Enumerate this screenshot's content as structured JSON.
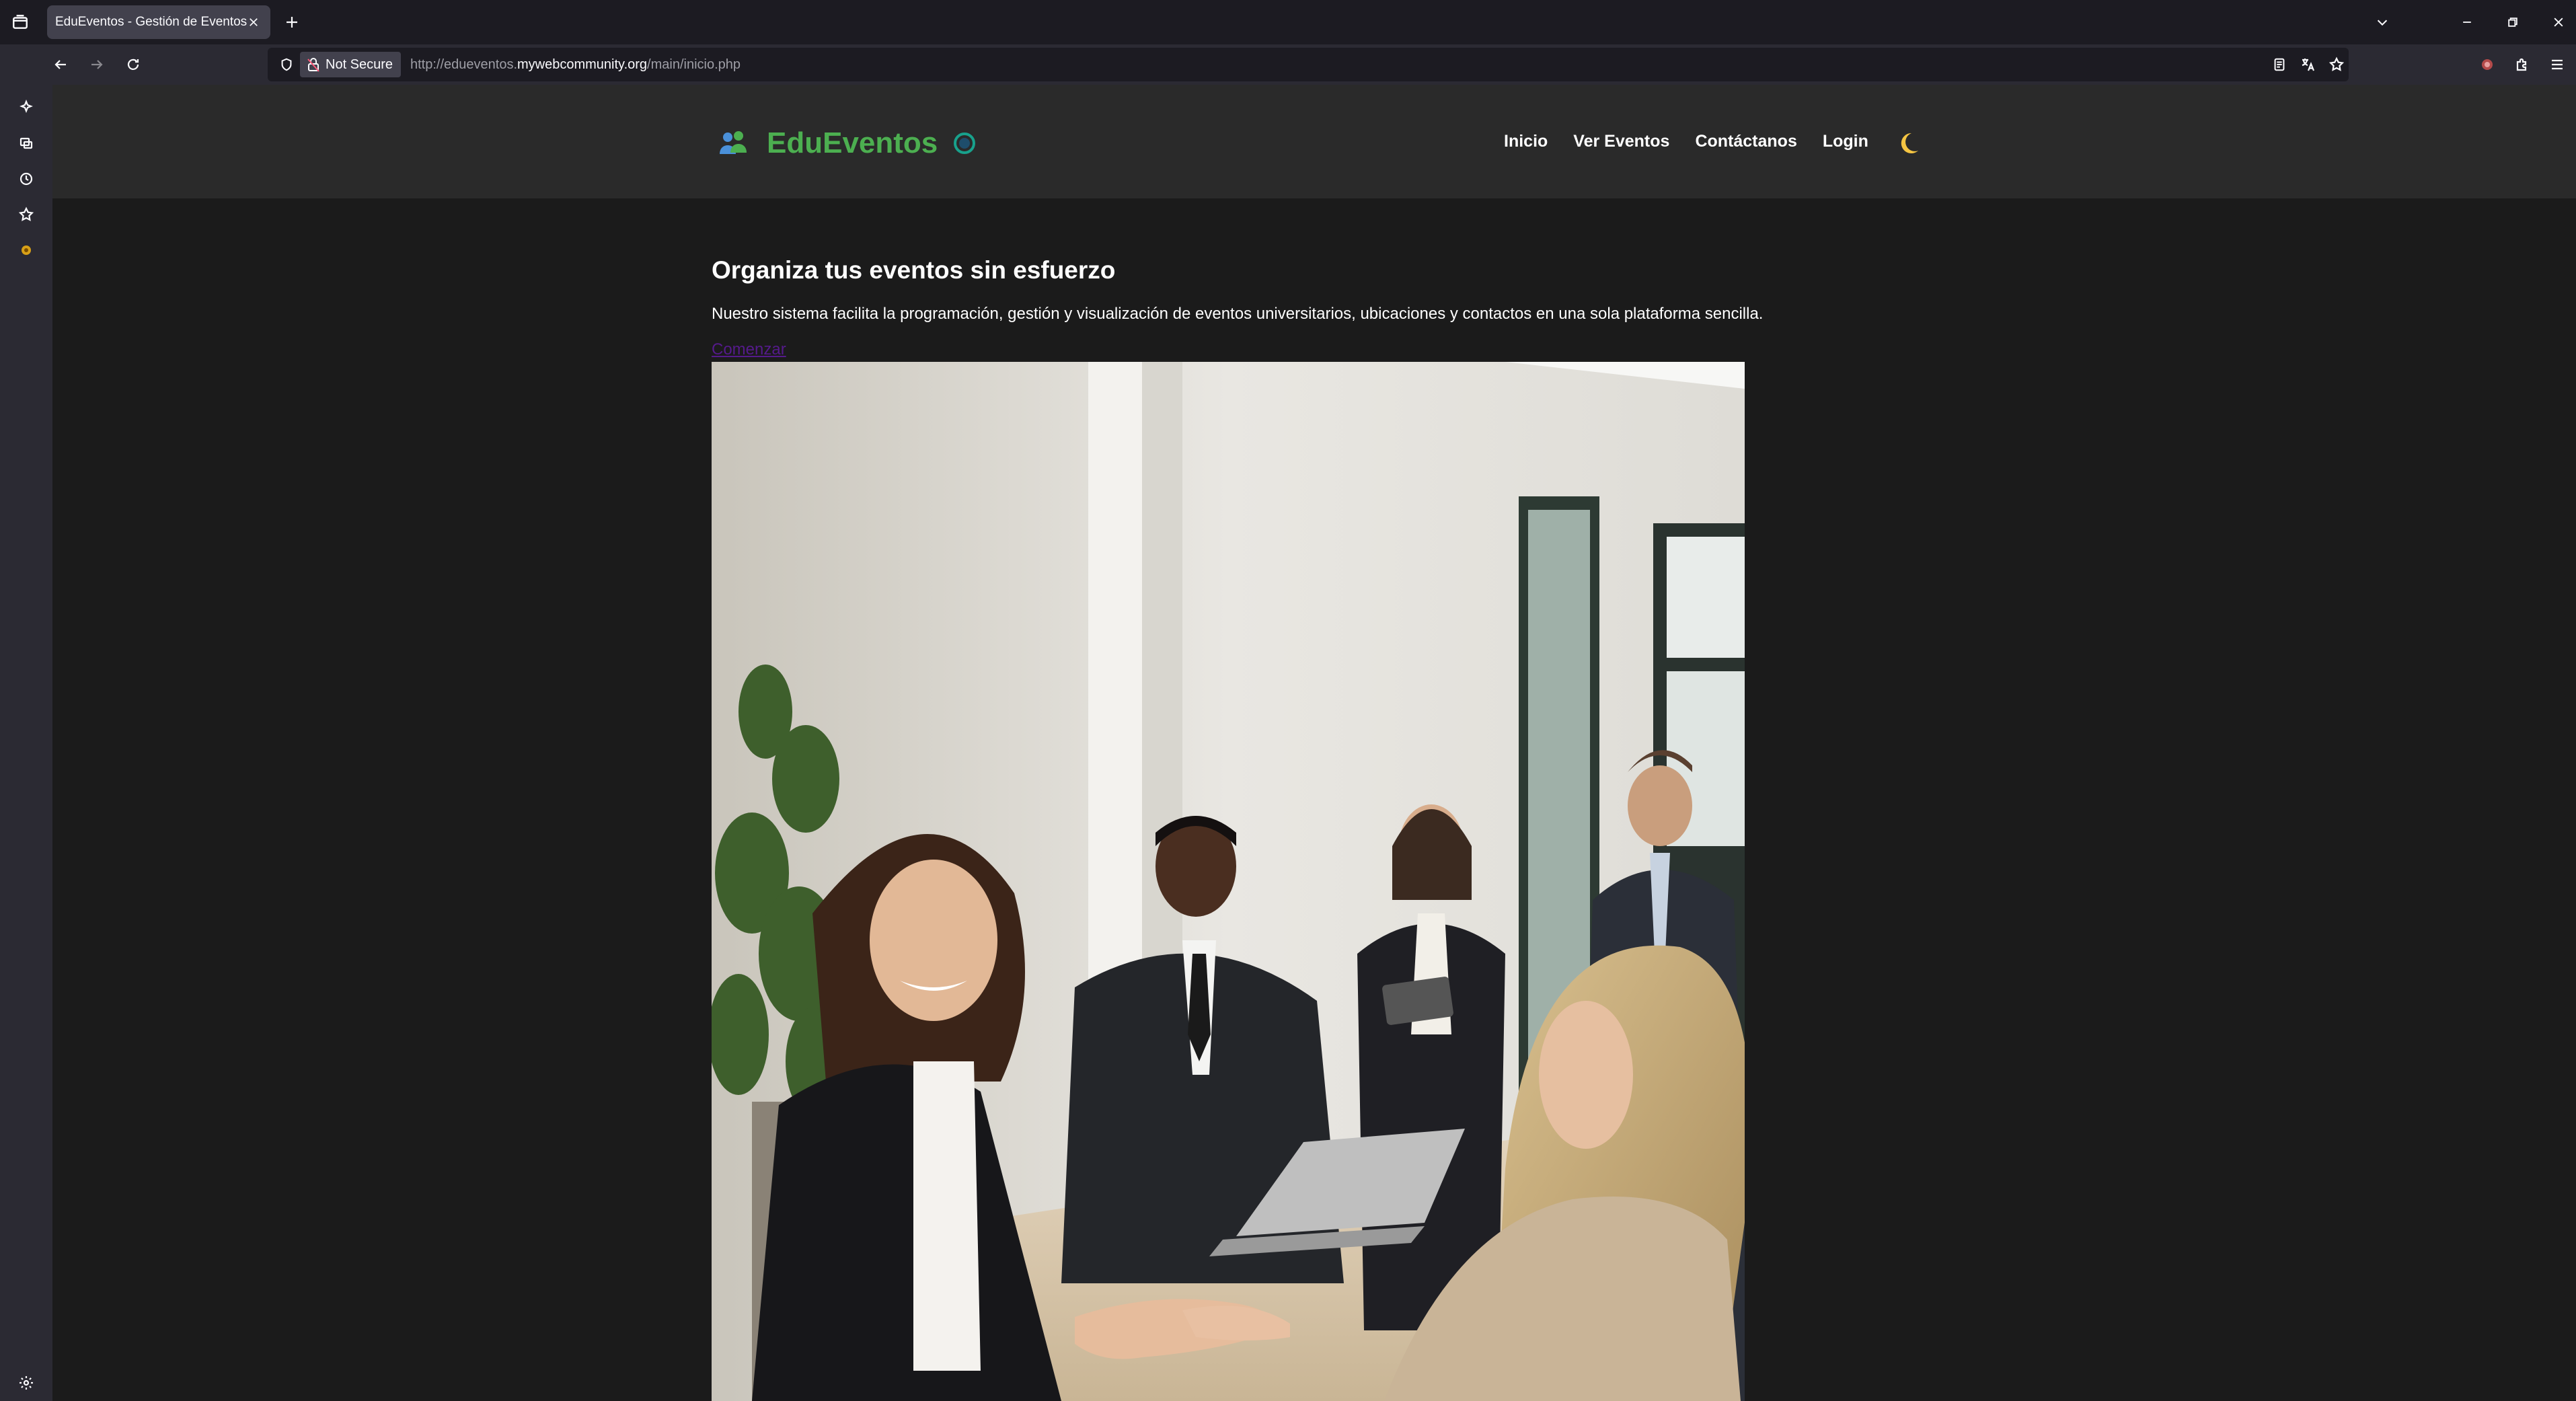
{
  "browser": {
    "tab_title": "EduEventos - Gestión de Eventos",
    "not_secure_label": "Not Secure",
    "url_prefix": "http://edueventos.",
    "url_host": "mywebcommunity.org",
    "url_path": "/main/inicio.php"
  },
  "site": {
    "brand_name": "EduEventos",
    "brand_color": "#4caf50",
    "nav": [
      "Inicio",
      "Ver Eventos",
      "Contáctanos",
      "Login"
    ],
    "theme_toggle_icon": "moon-icon"
  },
  "hero": {
    "title": "Organiza tus eventos sin esfuerzo",
    "description": "Nuestro sistema facilita la programación, gestión y visualización de eventos universitarios, ubicaciones y contactos en una sola plataforma sencilla.",
    "cta_label": "Comenzar",
    "image": "photo of business people shaking hands at a reception desk with colleagues and laptop"
  }
}
